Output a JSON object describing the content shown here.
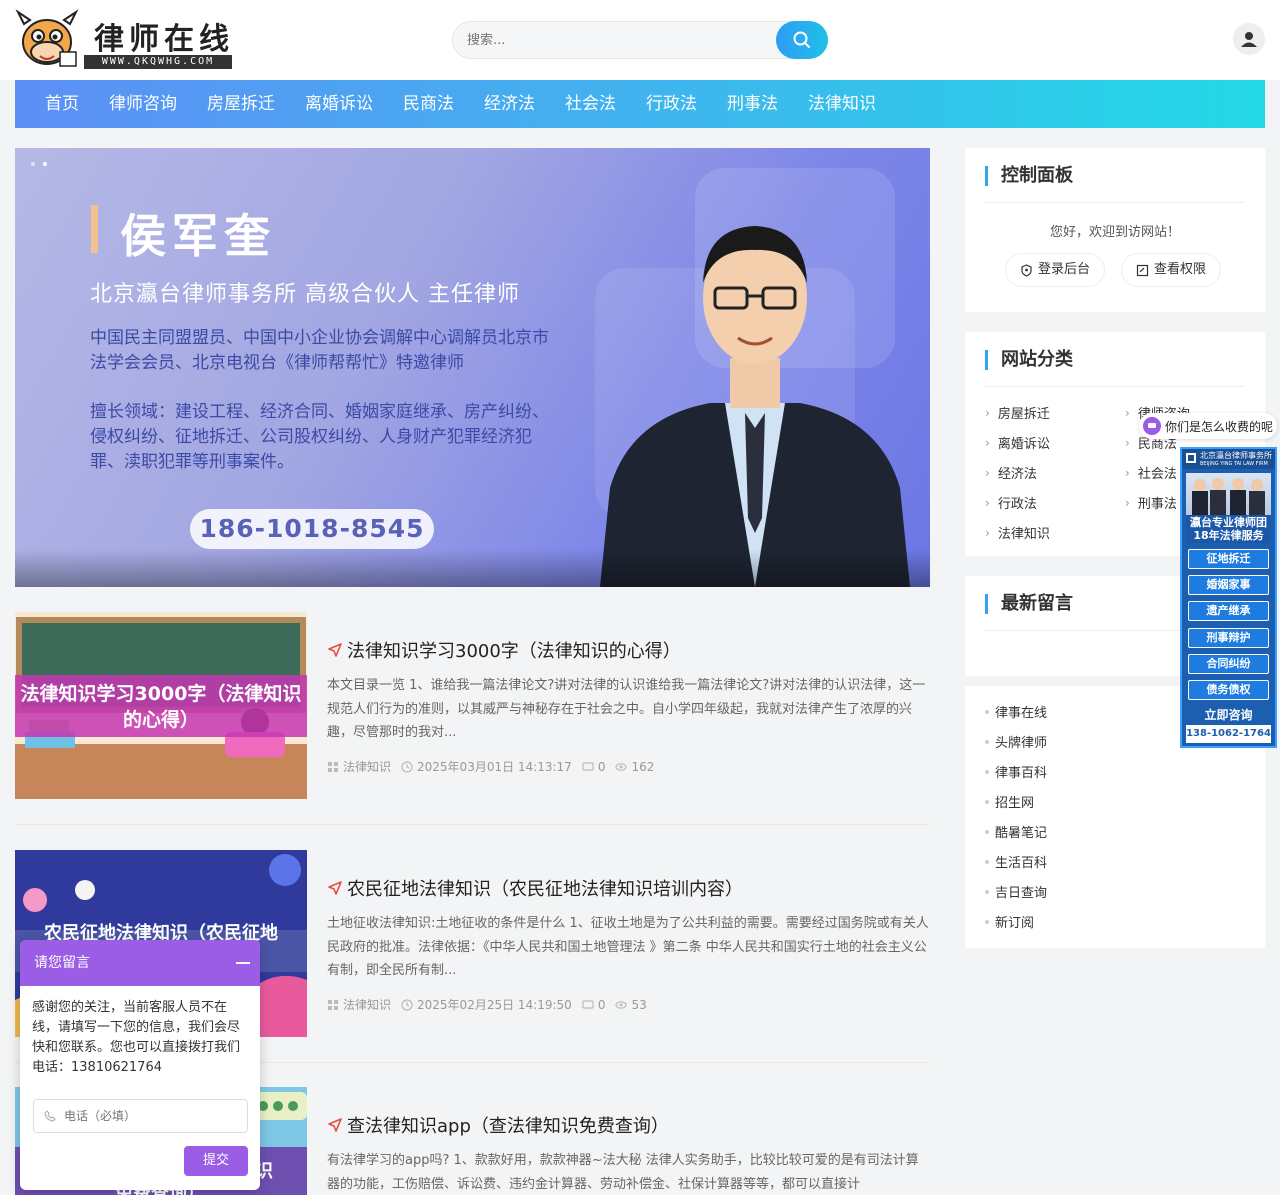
{
  "header": {
    "logo_title": "律师在线",
    "logo_sub": "WWW.QKQWHG.COM",
    "search_placeholder": "搜索..."
  },
  "nav": {
    "items": [
      "首页",
      "律师咨询",
      "房屋拆迁",
      "离婚诉讼",
      "民商法",
      "经济法",
      "社会法",
      "行政法",
      "刑事法",
      "法律知识"
    ]
  },
  "banner": {
    "name": "侯军奎",
    "subtitle": "北京瀛台律师事务所 高级合伙人 主任律师",
    "desc1": "中国民主同盟盟员、中国中小企业协会调解中心调解员北京市法学会会员、北京电视台《律师帮帮忙》特邀律师",
    "desc2": "擅长领域：建设工程、经济合同、婚姻家庭继承、房产纠纷、侵权纠纷、征地拆迁、公司股权纠纷、人身财产犯罪经济犯罪、渎职犯罪等刑事案件。",
    "phone": "186-1018-8545"
  },
  "articles": [
    {
      "title": "法律知识学习3000字（法律知识的心得）",
      "thumb_text": "法律知识学习3000字（法律知识的心得）",
      "excerpt": "本文目录一览 1、谁给我一篇法律论文?讲对法律的认识谁给我一篇法律论文?讲对法律的认识法律，这一规范人们行为的准则，以其威严与神秘存在于社会之中。自小学四年级起，我就对法律产生了浓厚的兴趣，尽管那时的我对...",
      "category": "法律知识",
      "date": "2025年03月01日 14:13:17",
      "comments": "0",
      "views": "162"
    },
    {
      "title": "农民征地法律知识（农民征地法律知识培训内容）",
      "thumb_text": "农民征地法律知识（农民征地",
      "excerpt": "土地征收法律知识:土地征收的条件是什么 1、征收土地是为了公共利益的需要。需要经过国务院或有关人民政府的批准。法律依据：《中华人民共和国土地管理法 》第二条 中华人民共和国实行土地的社会主义公有制，即全民所有制...",
      "category": "法律知识",
      "date": "2025年02月25日 14:19:50",
      "comments": "0",
      "views": "53"
    },
    {
      "title": "查法律知识app（查法律知识免费查询）",
      "thumb_text": "免费查询）",
      "thumb_text2": "识",
      "excerpt": "有法律学习的app吗? 1、款款好用，款款神器~法大秘 法律人实务助手，比较比较可爱的是有司法计算器的功能，工伤赔偿、诉讼费、违约金计算器、劳动补偿金、社保计算器等等，都可以直接计"
    }
  ],
  "sidebar": {
    "panel": {
      "title": "控制面板",
      "welcome": "您好，欢迎到访网站！",
      "login_label": "登录后台",
      "perm_label": "查看权限"
    },
    "categories": {
      "title": "网站分类",
      "left": [
        "房屋拆迁",
        "离婚诉讼",
        "经济法",
        "行政法",
        "法律知识"
      ],
      "right": [
        "律师咨询",
        "民商法",
        "社会法",
        "刑事法"
      ]
    },
    "messages": {
      "title": "最新留言"
    },
    "links": [
      "律事在线",
      "头牌律师",
      "律事百科",
      "招生网",
      "酷暑笔记",
      "生活百科",
      "吉日查询",
      "新订阅"
    ]
  },
  "chat_bubble": {
    "text": "你们是怎么收费的呢"
  },
  "ad": {
    "head": "北京瀛台律师事务所",
    "head_en": "BEIJING YING TAI LAW FIRM",
    "slogan1": "瀛台专业律师团",
    "slogan2": "18年法律服务",
    "buttons": [
      "征地拆迁",
      "婚姻家事",
      "遗产继承",
      "刑事辩护",
      "合同纠纷",
      "债务债权"
    ],
    "consult": "立即咨询",
    "phone": "138-1062-1764"
  },
  "message_box": {
    "title": "请您留言",
    "text": "感谢您的关注，当前客服人员不在线，请填写一下您的信息，我们会尽快和您联系。您也可以直接拨打我们电话：13810621764",
    "phone_placeholder": "电话（必填）",
    "submit": "提交"
  },
  "colors": {
    "accent": "#2ea7ef",
    "nav_start": "#5d8ff6",
    "nav_end": "#23d8e6",
    "purple": "#9b5de5"
  }
}
